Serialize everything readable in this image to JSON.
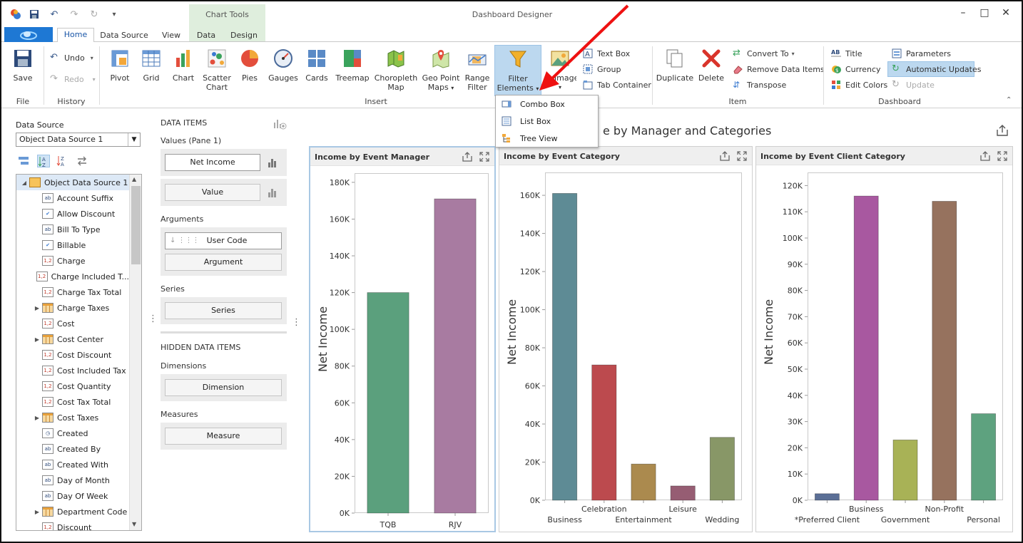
{
  "window": {
    "title": "Dashboard Designer"
  },
  "context_tab": {
    "title": "Chart Tools"
  },
  "tabs": [
    {
      "label": "Home"
    },
    {
      "label": "Data Source"
    },
    {
      "label": "View"
    },
    {
      "label": "Data"
    },
    {
      "label": "Design"
    }
  ],
  "ribbon": {
    "file": {
      "save": "Save",
      "group": "File"
    },
    "history": {
      "undo": "Undo",
      "redo": "Redo",
      "group": "History"
    },
    "insert": {
      "group": "Insert",
      "pivot": "Pivot",
      "grid": "Grid",
      "chart": "Chart",
      "scatter1": "Scatter",
      "scatter2": "Chart",
      "pies": "Pies",
      "gauges": "Gauges",
      "cards": "Cards",
      "treemap": "Treemap",
      "choro1": "Choropleth",
      "choro2": "Map",
      "geo1": "Geo Point",
      "geo2": "Maps",
      "range1": "Range",
      "range2": "Filter",
      "filter1": "Filter",
      "filter2": "Elements",
      "images1": "Images",
      "textbox": "Text Box",
      "groupitem": "Group",
      "tabcontainer": "Tab Container"
    },
    "item": {
      "group": "Item",
      "duplicate": "Duplicate",
      "delete": "Delete",
      "convert": "Convert To",
      "remove": "Remove Data Items",
      "transpose": "Transpose"
    },
    "dashboard": {
      "group": "Dashboard",
      "title": "Title",
      "currency": "Currency",
      "editcolors": "Edit Colors",
      "parameters": "Parameters",
      "autoupdates": "Automatic Updates",
      "update": "Update"
    }
  },
  "dropdown": {
    "items": [
      "Combo Box",
      "List Box",
      "Tree View"
    ]
  },
  "data_source": {
    "label": "Data Source",
    "selected": "Object Data Source 1",
    "root": "Object Data Source 1",
    "fields": [
      {
        "name": "Account Suffix",
        "icon": "ab",
        "expandable": false
      },
      {
        "name": "Allow Discount",
        "icon": "check",
        "expandable": false
      },
      {
        "name": "Bill To Type",
        "icon": "ab",
        "expandable": false
      },
      {
        "name": "Billable",
        "icon": "check",
        "expandable": false
      },
      {
        "name": "Charge",
        "icon": "num",
        "expandable": false
      },
      {
        "name": "Charge Included T...",
        "icon": "num",
        "expandable": false
      },
      {
        "name": "Charge Tax Total",
        "icon": "num",
        "expandable": false
      },
      {
        "name": "Charge Taxes",
        "icon": "table",
        "expandable": true
      },
      {
        "name": "Cost",
        "icon": "num",
        "expandable": false
      },
      {
        "name": "Cost Center",
        "icon": "table",
        "expandable": true
      },
      {
        "name": "Cost Discount",
        "icon": "num",
        "expandable": false
      },
      {
        "name": "Cost Included Tax",
        "icon": "num",
        "expandable": false
      },
      {
        "name": "Cost Quantity",
        "icon": "num",
        "expandable": false
      },
      {
        "name": "Cost Tax Total",
        "icon": "num",
        "expandable": false
      },
      {
        "name": "Cost Taxes",
        "icon": "table",
        "expandable": true
      },
      {
        "name": "Created",
        "icon": "clock",
        "expandable": false
      },
      {
        "name": "Created By",
        "icon": "ab",
        "expandable": false
      },
      {
        "name": "Created With",
        "icon": "ab",
        "expandable": false
      },
      {
        "name": "Day of Month",
        "icon": "ab",
        "expandable": false
      },
      {
        "name": "Day Of Week",
        "icon": "ab",
        "expandable": false
      },
      {
        "name": "Department Code",
        "icon": "table",
        "expandable": true
      },
      {
        "name": "Discount",
        "icon": "num",
        "expandable": false
      }
    ]
  },
  "data_items": {
    "header": "DATA ITEMS",
    "values_label": "Values (Pane 1)",
    "values": [
      "Net Income",
      "Value"
    ],
    "arguments_label": "Arguments",
    "arguments": [
      "User Code",
      "Argument"
    ],
    "series_label": "Series",
    "series": "Series",
    "hidden_header": "HIDDEN DATA ITEMS",
    "dimensions_label": "Dimensions",
    "dimension": "Dimension",
    "measures_label": "Measures",
    "measure": "Measure"
  },
  "dashboard": {
    "title": "e by Manager and Categories"
  },
  "chart_data": [
    {
      "type": "bar",
      "title": "Income by Event Manager",
      "ylabel": "Net Income",
      "categories": [
        "TQB",
        "RJV"
      ],
      "values": [
        120000,
        171000
      ],
      "colors": [
        "#5ba07d",
        "#a87ba1"
      ],
      "ylim": [
        0,
        185000
      ],
      "ticks": [
        0,
        20000,
        40000,
        60000,
        80000,
        100000,
        120000,
        140000,
        160000,
        180000
      ],
      "tick_labels": [
        "0K",
        "20K",
        "40K",
        "60K",
        "80K",
        "100K",
        "120K",
        "140K",
        "160K",
        "180K"
      ]
    },
    {
      "type": "bar",
      "title": "Income by Event Category",
      "ylabel": "Net Income",
      "categories": [
        "Business",
        "Celebration",
        "Entertainment",
        "Leisure",
        "Wedding"
      ],
      "values": [
        161000,
        71000,
        19000,
        7500,
        33000
      ],
      "colors": [
        "#5e8b95",
        "#bc4a4e",
        "#ab8a4e",
        "#965d73",
        "#889767"
      ],
      "ylim": [
        0,
        172000
      ],
      "ticks": [
        0,
        20000,
        40000,
        60000,
        80000,
        100000,
        120000,
        140000,
        160000
      ],
      "tick_labels": [
        "0K",
        "20K",
        "40K",
        "60K",
        "80K",
        "100K",
        "120K",
        "140K",
        "160K"
      ]
    },
    {
      "type": "bar",
      "title": "Income by Event Client Category",
      "ylabel": "Net Income",
      "categories": [
        "*Preferred Client",
        "Business",
        "Government",
        "Non-Profit",
        "Personal"
      ],
      "values": [
        2500,
        116000,
        23000,
        114000,
        33000
      ],
      "colors": [
        "#5b6f96",
        "#a858a0",
        "#a8b256",
        "#96725e",
        "#5ea27f"
      ],
      "ylim": [
        0,
        125000
      ],
      "ticks": [
        0,
        10000,
        20000,
        30000,
        40000,
        50000,
        60000,
        70000,
        80000,
        90000,
        100000,
        110000,
        120000
      ],
      "tick_labels": [
        "0K",
        "10K",
        "20K",
        "30K",
        "40K",
        "50K",
        "60K",
        "70K",
        "80K",
        "90K",
        "100K",
        "110K",
        "120K"
      ]
    }
  ]
}
